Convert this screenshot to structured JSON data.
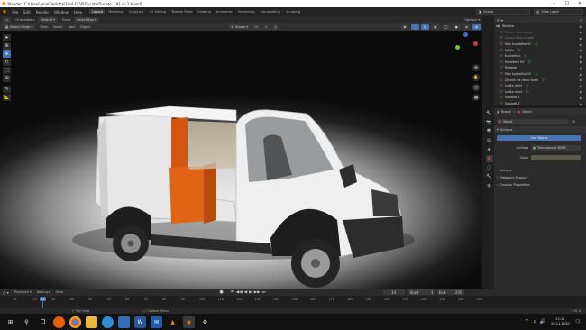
{
  "window": {
    "title": "Blender [C:\\Users\\jane\\Desktop\\Ford F150\\Ducato\\Ducato 1.91 sv 1.blend]",
    "controls": [
      "–",
      "☐",
      "✕"
    ]
  },
  "menu": {
    "items": [
      "File",
      "Edit",
      "Render",
      "Window",
      "Help"
    ],
    "workspaces": [
      "Layout",
      "Modeling",
      "Sculpting",
      "UV Editing",
      "Texture Paint",
      "Shading",
      "Animation",
      "Rendering",
      "Compositing",
      "Scripting"
    ],
    "active_workspace": "Layout",
    "scene": "Scene",
    "view_layer": "View Layer"
  },
  "tool_header": {
    "orientation_label": "Orientation:",
    "orientation_value": "Default",
    "drag_label": "Drag:",
    "drag_value": "Select Box",
    "options_label": "Options"
  },
  "viewport_header": {
    "mode": "Object Mode",
    "menus": [
      "View",
      "Select",
      "Add",
      "Object"
    ],
    "transform": "Global"
  },
  "outliner": {
    "rows": [
      {
        "name": "Window",
        "dim": false,
        "extra": ""
      },
      {
        "name": "Chrom lišta model",
        "dim": true,
        "extra": ""
      },
      {
        "name": "Chrom lišta zrcadel",
        "dim": true,
        "extra": ""
      },
      {
        "name": "Sklo kuchařka HC",
        "dim": false,
        "extra": "▽"
      },
      {
        "name": "Světlo",
        "dim": false,
        "extra": "▽"
      },
      {
        "name": "Kuchařkov",
        "dim": false,
        "extra": "▽"
      },
      {
        "name": "Rozložení HV",
        "dim": false,
        "extra": "▽"
      },
      {
        "name": "Podlaha",
        "dim": false,
        "extra": ""
      },
      {
        "name": "Sklo kuchařka HC",
        "dim": false,
        "extra": "▽"
      },
      {
        "name": "Zlevník na rámu dveří",
        "dim": false,
        "extra": "▽"
      },
      {
        "name": "Loďka dolní",
        "dim": false,
        "extra": "▽"
      },
      {
        "name": "Loďka horní",
        "dim": false,
        "extra": "▽"
      },
      {
        "name": "Šroubek 1",
        "dim": false,
        "extra": ""
      },
      {
        "name": "Šroubek 2",
        "dim": false,
        "extra": ""
      }
    ]
  },
  "properties": {
    "scene_label": "Scene",
    "world_label": "World",
    "world_name": "World",
    "surface_section": "Surface",
    "use_nodes_label": "Use Nodes",
    "surface_label": "Surface",
    "surface_value": "Transparent BSDF",
    "color_label": "Color",
    "sections": [
      "Volume",
      "Viewport Display",
      "Custom Properties"
    ]
  },
  "timeline": {
    "menus": [
      "Playback",
      "Keying",
      "View"
    ],
    "ticks": [
      "0",
      "10",
      "20",
      "30",
      "40",
      "50",
      "60",
      "70",
      "80",
      "90",
      "100",
      "110",
      "120",
      "130",
      "140",
      "150",
      "160",
      "170",
      "180",
      "190",
      "200",
      "210",
      "220",
      "230",
      "240",
      "250"
    ],
    "current_frame": "14",
    "current_frame_field": "14",
    "start_label": "Start",
    "start_value": "1",
    "end_label": "End",
    "end_value": "250"
  },
  "status": {
    "left": "Pan View",
    "middle": "Context Menu",
    "version": "2.91.0"
  },
  "taskbar": {
    "time": "22:11",
    "date": "20.11.2020"
  },
  "colors": {
    "accent": "#4772b3",
    "orange": "#e06414",
    "viewport_bg": "#0b0b0b",
    "panel_bg": "#2b2b2b"
  }
}
